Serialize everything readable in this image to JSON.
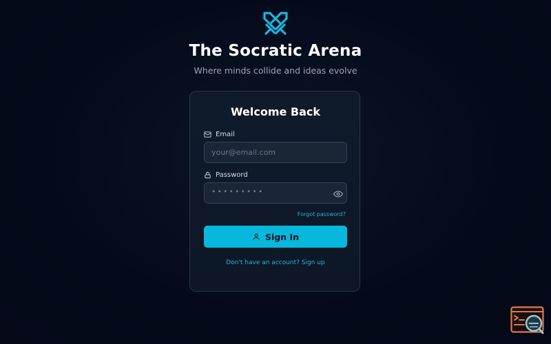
{
  "header": {
    "logo_icon": "crossed-swords-icon",
    "title": "The Socratic Arena",
    "subtitle": "Where minds collide and ideas evolve"
  },
  "login_card": {
    "heading": "Welcome Back",
    "email": {
      "icon": "mail-icon",
      "label": "Email",
      "placeholder": "your@email.com",
      "value": ""
    },
    "password": {
      "icon": "lock-icon",
      "label": "Password",
      "masked_value": "•••••••••",
      "toggle_icon": "eye-icon"
    },
    "forgot_password": "Forgot password?",
    "sign_in_button": {
      "icon": "user-icon",
      "label": "Sign In"
    },
    "sign_up_link": "Don't have an account? Sign up"
  },
  "floating_widget": {
    "icon": "terminal-search-icon"
  },
  "colors": {
    "background": "#050a1a",
    "card": "#0f1a2b",
    "accent": "#08b8dc",
    "link": "#22b5e0",
    "input": "#1a2536",
    "widget": "#e0794a"
  }
}
